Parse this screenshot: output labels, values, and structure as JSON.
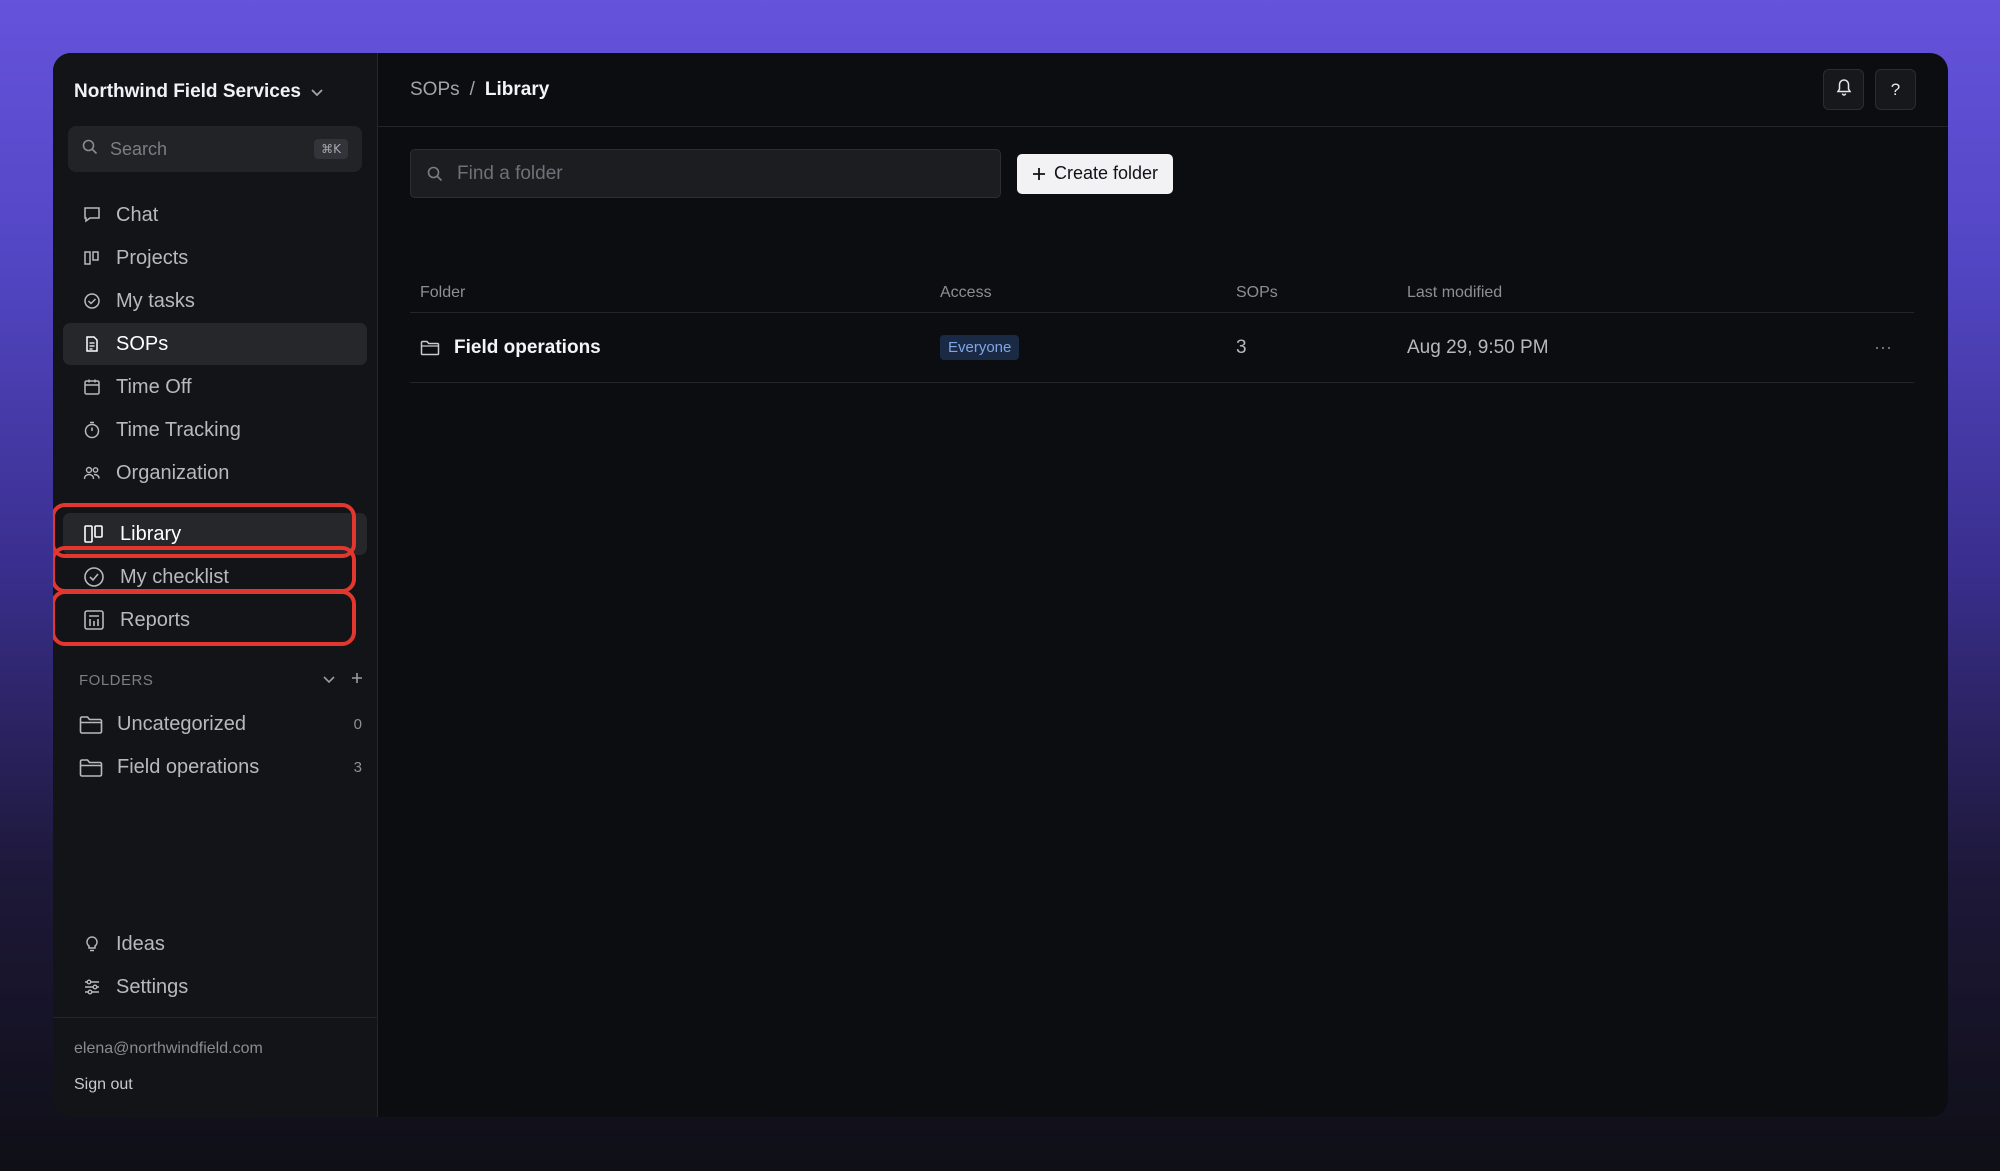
{
  "workspace": {
    "name": "Northwind Field Services"
  },
  "search": {
    "placeholder": "Search",
    "shortcut": "⌘K"
  },
  "nav": [
    {
      "label": "Chat",
      "icon": "chat-icon",
      "active": false
    },
    {
      "label": "Projects",
      "icon": "columns-icon",
      "active": false
    },
    {
      "label": "My tasks",
      "icon": "check-circle-icon",
      "active": false
    },
    {
      "label": "SOPs",
      "icon": "document-icon",
      "active": true
    },
    {
      "label": "Time Off",
      "icon": "calendar-icon",
      "active": false
    },
    {
      "label": "Time Tracking",
      "icon": "stopwatch-icon",
      "active": false
    },
    {
      "label": "Organization",
      "icon": "people-icon",
      "active": false
    }
  ],
  "sop_nav": [
    {
      "label": "Library",
      "icon": "library-icon",
      "active": true
    },
    {
      "label": "My checklist",
      "icon": "check-circle-icon",
      "active": false
    },
    {
      "label": "Reports",
      "icon": "chart-icon",
      "active": false
    }
  ],
  "folders": {
    "header": "FOLDERS",
    "items": [
      {
        "name": "Uncategorized",
        "count": "0"
      },
      {
        "name": "Field operations",
        "count": "3"
      }
    ]
  },
  "bottom_nav": [
    {
      "label": "Ideas",
      "icon": "lightbulb-icon"
    },
    {
      "label": "Settings",
      "icon": "sliders-icon"
    }
  ],
  "user": {
    "email": "elena@northwindfield.com",
    "signout": "Sign out"
  },
  "breadcrumb": {
    "parent": "SOPs",
    "separator": "/",
    "current": "Library"
  },
  "topbar": {
    "help": "?"
  },
  "find": {
    "placeholder": "Find a folder"
  },
  "create_button": {
    "label": "Create folder"
  },
  "table": {
    "columns": [
      "Folder",
      "Access",
      "SOPs",
      "Last modified"
    ],
    "rows": [
      {
        "folder": "Field operations",
        "access": "Everyone",
        "sops": "3",
        "modified": "Aug 29, 9:50 PM",
        "more": "···"
      }
    ]
  },
  "colors": {
    "highlight": "#e2372f",
    "badge_text": "#7fa6e6",
    "badge_bg": "#1a2a45"
  }
}
